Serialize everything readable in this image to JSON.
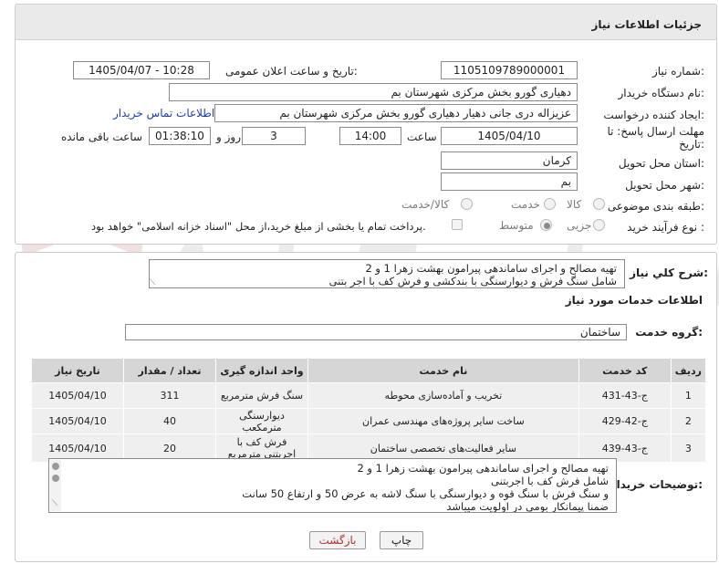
{
  "header": {
    "title": "جزئیات اطلاعات نیاز"
  },
  "labels": {
    "need_number": "شماره نیاز:",
    "announce_datetime": "تاریخ و ساعت اعلان عمومی:",
    "buyer_org": "نام دستگاه خریدار:",
    "requester": "ایجاد کننده درخواست:",
    "contact_link": "اطلاعات تماس خریدار",
    "deadline": "مهلت ارسال پاسخ: تا تاریخ:",
    "time_word": "ساعت",
    "days_word": "روز و",
    "remaining": "ساعت باقی مانده",
    "province": "استان محل تحویل:",
    "city": "شهر محل تحویل:",
    "category": "طبقه بندی موضوعی:",
    "purchase_type": "نوع فرآیند خرید :",
    "summary": "شرح کلي نياز:",
    "services_info": "اطلاعات خدمات مورد نیاز",
    "service_group": "گروه خدمت:",
    "buyer_notes": "توضیحات خریدار:"
  },
  "fields": {
    "need_number": "1105109789000001",
    "announce_datetime": "1405/04/07 - 10:28",
    "buyer_org": "دهیاری گورو بخش مرکزی شهرستان بم",
    "requester": "عزیزاله دری جانی دهیار دهیاری گورو بخش مرکزی شهرستان بم",
    "deadline_date": "1405/04/10",
    "deadline_time": "14:00",
    "days": "3",
    "remaining_time": "01:38:10",
    "province": "کرمان",
    "city": "بم",
    "service_group": "ساختمان"
  },
  "category_options": [
    {
      "label": "کالا",
      "selected": false
    },
    {
      "label": "خدمت",
      "selected": false
    },
    {
      "label": "کالا/خدمت",
      "selected": false
    }
  ],
  "purchase_options": [
    {
      "label": "جزیی",
      "selected": false
    },
    {
      "label": "متوسط",
      "selected": true
    }
  ],
  "payment_note": "پرداخت تمام یا بخشی از مبلغ خرید،از محل \"اسناد خزانه اسلامی\" خواهد بود.",
  "summary_lines": [
    "تهیه مصالح و اجرای ساماندهی پیرامون بهشت زهرا 1 و 2",
    "شامل سنگ فرش و دیوارسنگی با بندکشی و  فرش کف با اجر بتنی"
  ],
  "table": {
    "headers": [
      "ردیف",
      "کد خدمت",
      "نام خدمت",
      "واحد اندازه گیری",
      "تعداد / مقدار",
      "تاریخ نیاز"
    ],
    "rows": [
      [
        "1",
        "ج-43-431",
        "تخریب و آماده‌سازی محوطه",
        "سنگ فرش مترمربع",
        "311",
        "1405/04/10"
      ],
      [
        "2",
        "ج-42-429",
        "ساخت سایر پروژه‌های مهندسی عمران",
        "دیوارسنگی مترمکعب",
        "40",
        "1405/04/10"
      ],
      [
        "3",
        "ج-43-439",
        "سایر فعالیت‌های تخصصی ساختمان",
        "فرش کف با اجربتنی مترمربع",
        "20",
        "1405/04/10"
      ]
    ]
  },
  "notes_lines": [
    "تهیه مصالح و اجرای ساماندهی پیرامون بهشت زهرا 1 و 2",
    "شامل فرش کف با اجربتنی",
    "و سنگ فرش با سنگ قوه  و دیوارسنگی  با سنگ لاشه به عرض 50 و ارتفاع 50 سانت",
    "ضمنا پیمانکار بومی در اولویت میباشد"
  ],
  "buttons": {
    "print": "چاپ",
    "back": "بازگشت"
  },
  "colors": {
    "link": "#1f3fa6",
    "back_button_text": "#b03030",
    "header_bg": "#eaeaea"
  }
}
